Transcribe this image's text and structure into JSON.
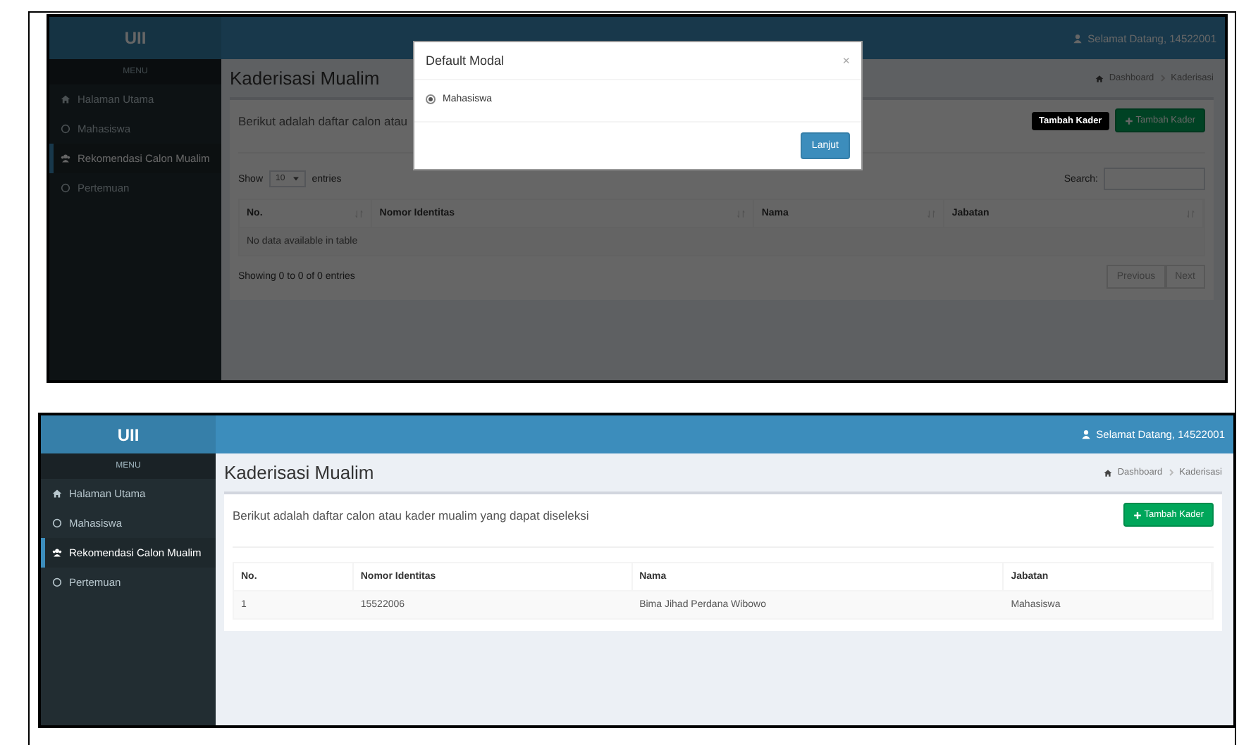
{
  "figures": [
    {
      "kind": "modal",
      "brand": "UII",
      "user_greeting": "Selamat Datang, 14522001",
      "menu_label": "MENU",
      "menu": [
        {
          "label": "Halaman Utama",
          "selected": false
        },
        {
          "label": "Mahasiswa",
          "selected": false
        },
        {
          "label": "Rekomendasi Calon Mualim",
          "selected": true
        },
        {
          "label": "Pertemuan",
          "selected": false
        }
      ],
      "page_title": "Kaderisasi Mualim",
      "breadcrumb": [
        "Dashboard",
        "Kaderisasi"
      ],
      "description": "Berikut adalah daftar calon atau",
      "add_button": "Tambah Kader",
      "tooltip": "Tambah Kader",
      "length_control": {
        "prefix": "Show",
        "value": "10",
        "suffix": "entries"
      },
      "search_label": "Search:",
      "sortable": true,
      "columns": [
        "No.",
        "Nomor Identitas",
        "Nama",
        "Jabatan"
      ],
      "empty_message": "No data available in table",
      "info": "Showing 0 to 0 of 0 entries",
      "pagination": [
        "Previous",
        "Next"
      ],
      "modal": {
        "title": "Default Modal",
        "close": "×",
        "options": [
          {
            "label": "Mahasiswa",
            "selected": true
          }
        ],
        "button": "Lanjut"
      }
    },
    {
      "kind": "plain",
      "brand": "UII",
      "user_greeting": "Selamat Datang, 14522001",
      "menu_label": "MENU",
      "menu": [
        {
          "label": "Halaman Utama",
          "selected": false
        },
        {
          "label": "Mahasiswa",
          "selected": false
        },
        {
          "label": "Rekomendasi Calon Mualim",
          "selected": true
        },
        {
          "label": "Pertemuan",
          "selected": false
        }
      ],
      "page_title": "Kaderisasi Mualim",
      "breadcrumb": [
        "Dashboard",
        "Kaderisasi"
      ],
      "description": "Berikut adalah daftar calon atau kader mualim yang dapat diseleksi",
      "add_button": "Tambah Kader",
      "sortable": false,
      "columns": [
        "No.",
        "Nomor Identitas",
        "Nama",
        "Jabatan"
      ],
      "rows": [
        [
          "1",
          "15522006",
          "Bima Jihad Perdana Wibowo",
          "Mahasiswa"
        ]
      ]
    }
  ]
}
